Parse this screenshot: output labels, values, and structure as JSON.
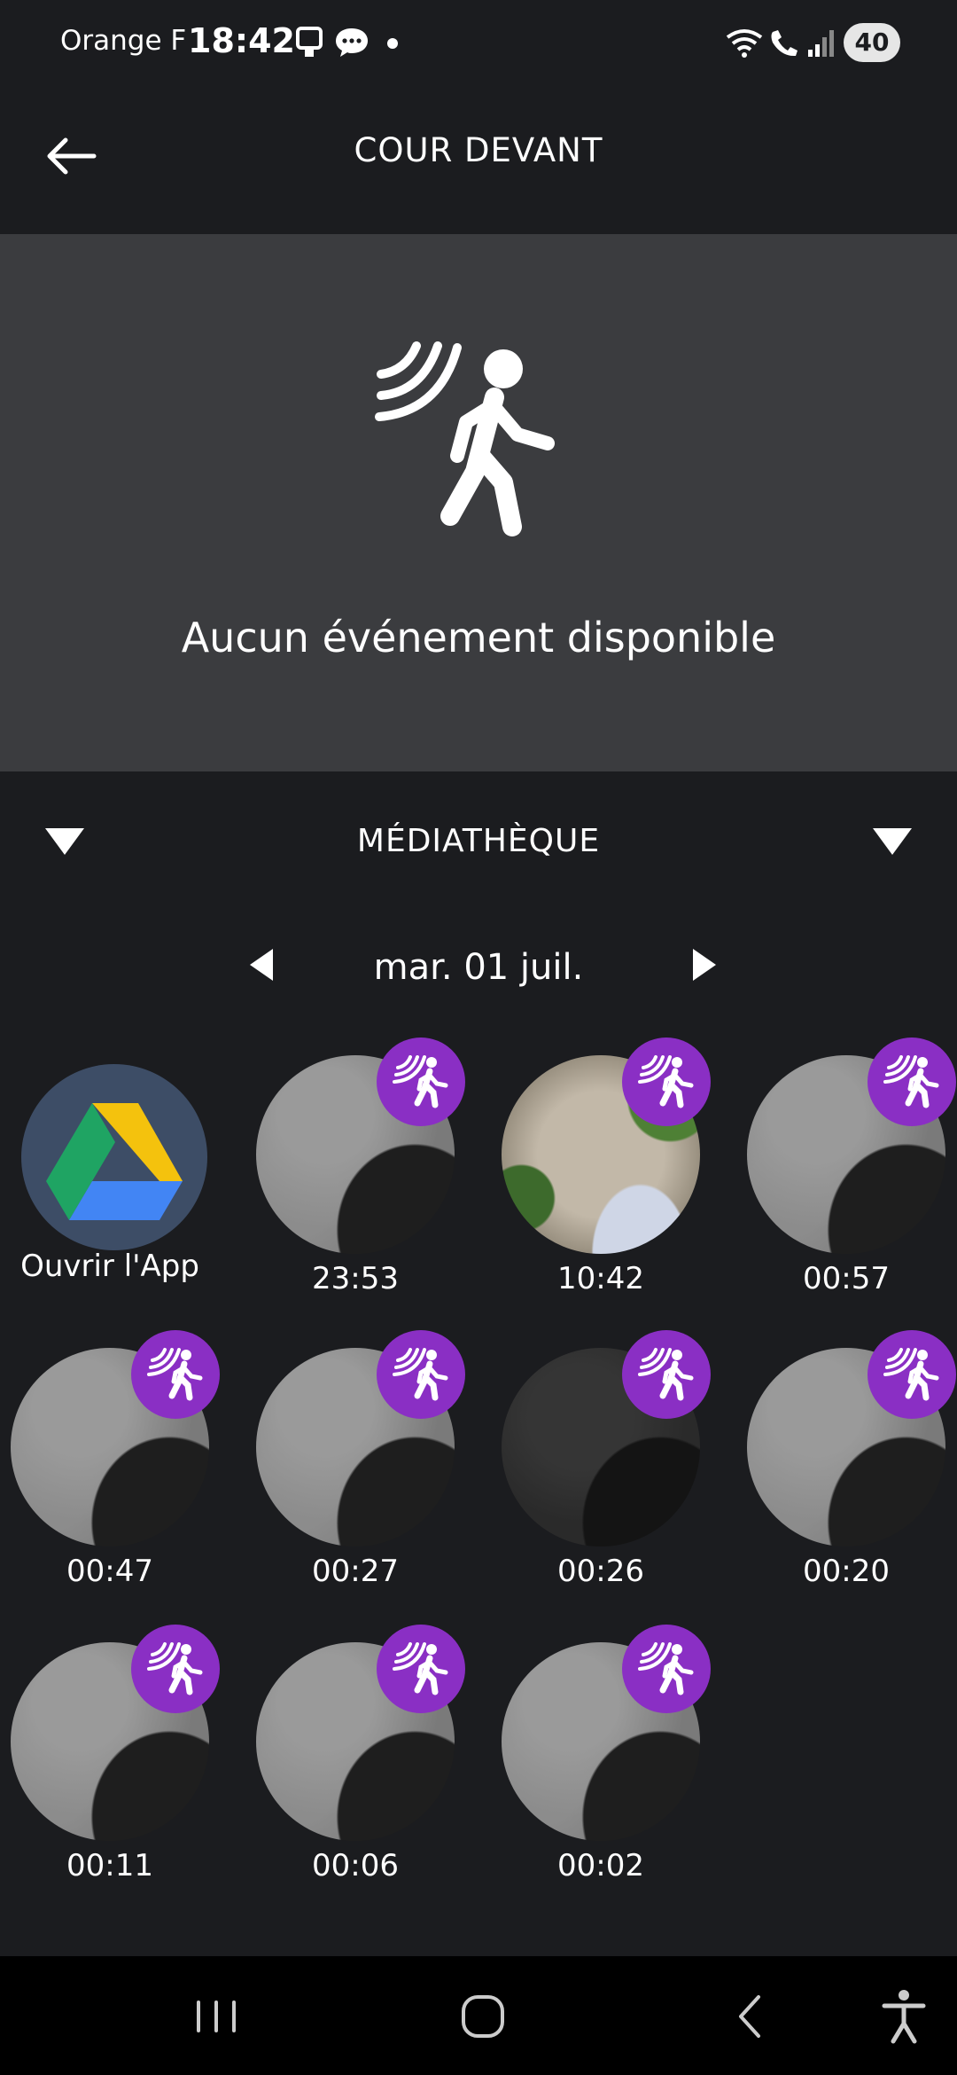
{
  "status_bar": {
    "carrier": "Orange F",
    "time": "18:42",
    "battery": "40",
    "icons": [
      "screenshot-icon",
      "message-icon",
      "dot-icon",
      "wifi-icon",
      "wifi-call-icon",
      "signal-icon"
    ]
  },
  "header": {
    "title": "COUR DEVANT",
    "back_icon": "arrow-left-icon"
  },
  "event_panel": {
    "icon": "motion-walker-icon",
    "message": "Aucun événement disponible"
  },
  "media": {
    "title": "MÉDIATHÈQUE",
    "date": "mar. 01 juil.",
    "open_app_label": "Ouvrir l'App",
    "clips": [
      {
        "time": "23:53",
        "style": "gray"
      },
      {
        "time": "10:42",
        "style": "yard"
      },
      {
        "time": "00:57",
        "style": "gray"
      },
      {
        "time": "00:47",
        "style": "gray"
      },
      {
        "time": "00:27",
        "style": "gray"
      },
      {
        "time": "00:26",
        "style": "dark"
      },
      {
        "time": "00:20",
        "style": "gray"
      },
      {
        "time": "00:11",
        "style": "gray"
      },
      {
        "time": "00:06",
        "style": "gray"
      },
      {
        "time": "00:02",
        "style": "gray"
      }
    ],
    "badge_color": "#8a2fc4"
  },
  "nav": {
    "items": [
      "recent-apps-icon",
      "home-icon",
      "back-icon",
      "accessibility-icon"
    ]
  }
}
